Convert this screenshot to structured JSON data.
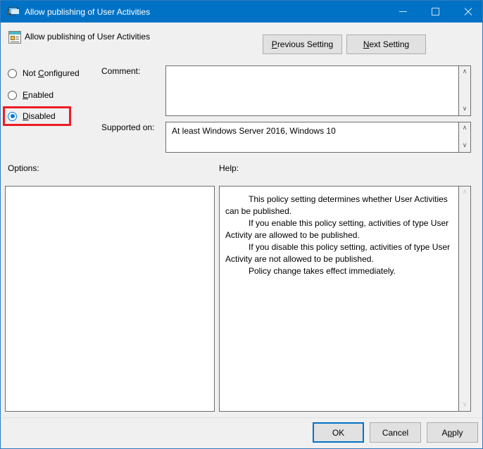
{
  "window": {
    "title": "Allow publishing of User Activities",
    "icon": "computer-monitor-icon",
    "caption_buttons": {
      "minimize": "minimize-icon",
      "maximize": "maximize-icon",
      "close": "close-icon"
    }
  },
  "header": {
    "policy_icon": "group-policy-setting-icon",
    "title": "Allow publishing of User Activities",
    "previous_setting_label": "Previous Setting",
    "previous_setting_accel": "P",
    "next_setting_label": "Next Setting",
    "next_setting_accel": "N"
  },
  "state_options": {
    "selected": "Disabled",
    "highlight_color": "#ed1c24",
    "accent_color": "#0078d7",
    "items": [
      {
        "label": "Not Configured",
        "accel": "C",
        "pre": "Not ",
        "post": "onfigured",
        "checked": false
      },
      {
        "label": "Enabled",
        "accel": "E",
        "pre": "",
        "post": "nabled",
        "checked": false
      },
      {
        "label": "Disabled",
        "accel": "D",
        "pre": "",
        "post": "isabled",
        "checked": true
      }
    ]
  },
  "comment": {
    "label": "Comment:",
    "value": "",
    "placeholder": ""
  },
  "supported_on": {
    "label": "Supported on:",
    "value": "At least Windows Server 2016, Windows 10"
  },
  "options": {
    "label": "Options:",
    "content": ""
  },
  "help": {
    "label": "Help:",
    "paragraphs": [
      "This policy setting determines whether User Activities can be published.",
      "If you enable this policy setting, activities of type User Activity are allowed to be published.",
      "If you disable this policy setting, activities of type User Activity are not allowed to be published.",
      "Policy change takes effect immediately."
    ]
  },
  "footer": {
    "ok_label": "OK",
    "cancel_label": "Cancel",
    "apply_label": "Apply",
    "apply_accel": "p",
    "default_button": "OK"
  },
  "scroll_glyphs": {
    "up": "∧",
    "down": "∨"
  }
}
